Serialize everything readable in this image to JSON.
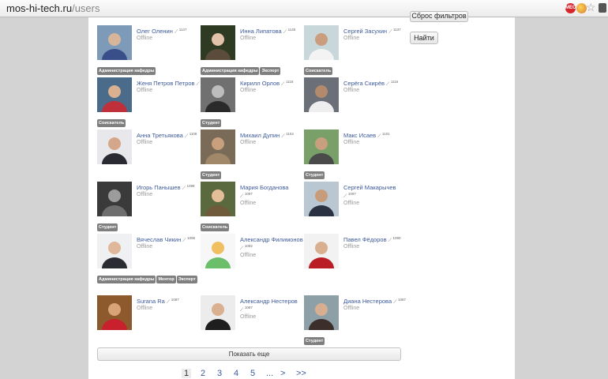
{
  "browser": {
    "url_host": "mos-hi-tech.ru",
    "url_path": "/users",
    "ext1_label": "МЕО"
  },
  "sidebar": {
    "reset_label": "Сброс фильтров",
    "find_label": "Найти"
  },
  "users": [
    {
      "name": "Олег Оленин",
      "rating": "1147",
      "status": "Offline",
      "badges": [
        "Администрация кафедры"
      ]
    },
    {
      "name": "Инна Липатова",
      "rating": "1145",
      "status": "Offline",
      "badges": [
        "Администрация кафедры",
        "Эксперт"
      ]
    },
    {
      "name": "Сергей Засухин",
      "rating": "1137",
      "status": "Offline",
      "badges": [
        "Соискатель"
      ]
    },
    {
      "name": "Женя Петров Петров",
      "rating": "1118",
      "status": "Offline",
      "badges": [
        "Соискатель"
      ]
    },
    {
      "name": "Кирилл Орлов",
      "rating": "1118",
      "status": "Offline",
      "badges": [
        "Студент"
      ]
    },
    {
      "name": "Серёга Скирёв",
      "rating": "1116",
      "status": "Offline",
      "badges": []
    },
    {
      "name": "Анна Третьякова",
      "rating": "1108",
      "status": "Offline",
      "badges": []
    },
    {
      "name": "Михаил Дупин",
      "rating": "1104",
      "status": "Offline",
      "badges": [
        "Студент"
      ]
    },
    {
      "name": "Макс Исаев",
      "rating": "1101",
      "status": "Offline",
      "badges": [
        "Студент"
      ]
    },
    {
      "name": "Игорь Панышев",
      "rating": "1098",
      "status": "Offline",
      "badges": [
        "Студент"
      ]
    },
    {
      "name": "Мария Богданова",
      "rating": "1097",
      "status": "Offline",
      "badges": [
        "Соискатель"
      ]
    },
    {
      "name": "Сергей Макарычев",
      "rating": "1097",
      "status": "Offline",
      "badges": []
    },
    {
      "name": "Вячеслав Чикин",
      "rating": "1096",
      "status": "Offline",
      "badges": [
        "Администрация кафедры",
        "Ментор",
        "Эксперт"
      ]
    },
    {
      "name": "Александр Филимонов",
      "rating": "1092",
      "status": "Offline",
      "badges": []
    },
    {
      "name": "Павел Фёдоров",
      "rating": "1090",
      "status": "Offline",
      "badges": []
    },
    {
      "name": "Surana Ra",
      "rating": "1087",
      "status": "Offline",
      "badges": []
    },
    {
      "name": "Александр Нестеров",
      "rating": "1087",
      "status": "Offline",
      "badges": []
    },
    {
      "name": "Диана Нестерова",
      "rating": "1087",
      "status": "Offline",
      "badges": [
        "Студент"
      ]
    }
  ],
  "show_more_label": "Показать еще",
  "pagination": [
    "1",
    "2",
    "3",
    "4",
    "5",
    "...",
    ">",
    ">>"
  ],
  "colors": {
    "link": "#3c5a9a",
    "badge": "#7f7f7f",
    "page_bg": "#d3d3d3"
  }
}
